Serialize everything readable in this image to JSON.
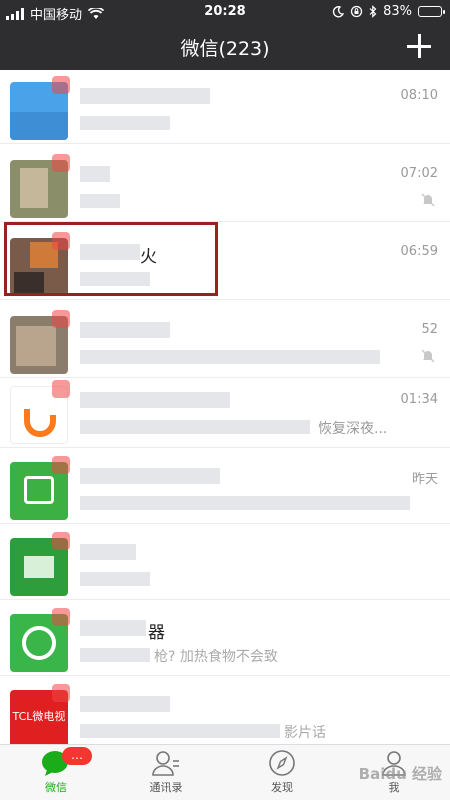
{
  "status": {
    "carrier": "中国移动",
    "time": "20:28",
    "battery": "83%",
    "battery_level": 0.83
  },
  "header": {
    "title": "微信(223)"
  },
  "chats": [
    {
      "time": "08:10",
      "avatar_color": "#4aa3e8",
      "muted": false
    },
    {
      "name": "",
      "time": "07:02",
      "avatar_color": "#8a8f6a",
      "muted": true
    },
    {
      "name": "火",
      "time": "06:59",
      "avatar_color": "#7a5a48",
      "muted": false
    },
    {
      "time": "52",
      "avatar_color": "#8b7d6b",
      "muted": true
    },
    {
      "msg": "恢复深夜...",
      "time": "01:34",
      "avatar_color": "#ff7a1a",
      "muted": false
    },
    {
      "time": "昨天",
      "avatar_color": "#3cb043",
      "muted": false
    },
    {
      "time": "",
      "avatar_color": "#2e9e3d",
      "muted": false
    },
    {
      "name": "器",
      "msg": "枪? 加热食物不会致",
      "time": "",
      "avatar_color": "#39b54a",
      "muted": false
    },
    {
      "name": "",
      "msg": "影片话",
      "time": "",
      "avatar_color": "#e02020",
      "avatar_text": "TCL微电视",
      "muted": false
    }
  ],
  "tabs": [
    {
      "label": "微信",
      "active": true,
      "badge": "…"
    },
    {
      "label": "通讯录",
      "active": false
    },
    {
      "label": "发现",
      "active": false
    },
    {
      "label": "我",
      "active": false
    }
  ],
  "watermark": "Baidu 经验",
  "colors": {
    "nav_bg": "#2e2e30",
    "accent": "#1aad19",
    "badge": "#f43530",
    "highlight": "#9b2020"
  }
}
